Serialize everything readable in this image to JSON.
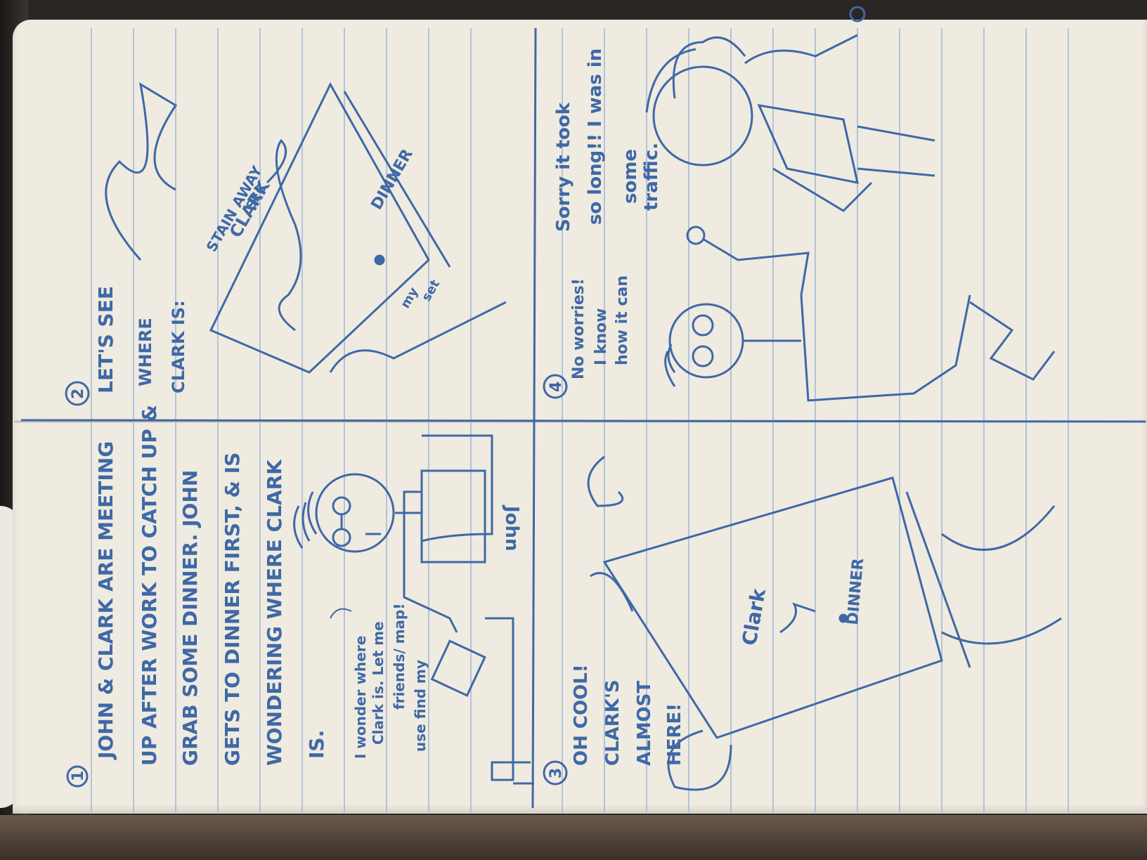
{
  "panel_1": {
    "number": "1",
    "caption_lines": [
      "JOHN & CLARK ARE MEETING",
      "UP AFTER WORK TO CATCH UP &",
      "GRAB SOME DINNER. JOHN",
      "GETS TO DINNER FIRST, & IS",
      "WONDERING WHERE CLARK",
      "IS."
    ],
    "thought_lines": [
      "I wonder where",
      "Clark is. Let me",
      "use find my",
      "friends/ map!"
    ],
    "character_label": "John"
  },
  "panel_2": {
    "number": "2",
    "caption_lines": [
      "LET'S SEE",
      "WHERE",
      "CLARK IS:"
    ],
    "map_labels": [
      "STAIN AWAY",
      "CLARK",
      "SEC",
      "DINNER",
      "my",
      "set"
    ]
  },
  "panel_3": {
    "number": "3",
    "caption_lines": [
      "OH COOL!",
      "CLARK'S",
      "ALMOST",
      "HERE!"
    ],
    "map_labels": [
      "Clark",
      "DINNER"
    ]
  },
  "panel_4": {
    "number": "4",
    "speech_john": [
      "No worries!",
      "I know",
      "how it can"
    ],
    "speech_clark": [
      "Sorry it took",
      "so long!! I was in",
      "some",
      "traffic."
    ]
  },
  "colors": {
    "ink": "#3f68a6",
    "paper": "#efebe0",
    "rule": "#8ca8cf"
  }
}
